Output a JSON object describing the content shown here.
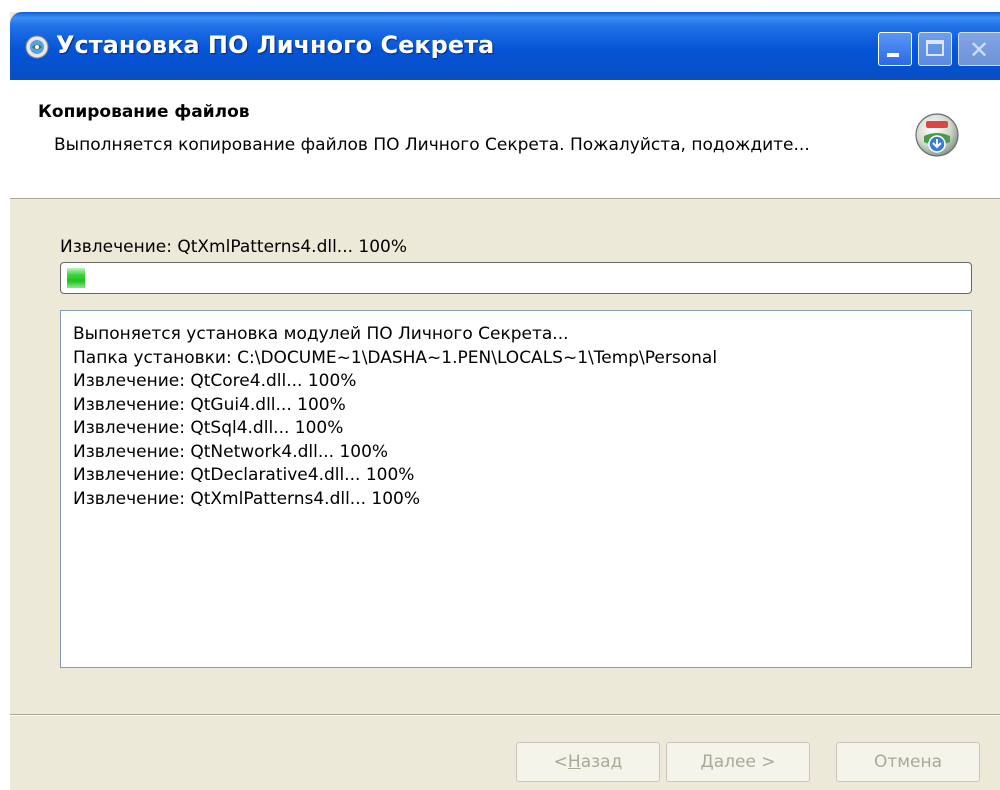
{
  "window": {
    "title": "Установка ПО Личного Секрета",
    "icon": "shield-globe-icon",
    "controls": [
      "minimize-icon",
      "maximize-icon",
      "close-icon"
    ]
  },
  "header": {
    "title": "Копирование файлов",
    "description": "Выполняется копирование файлов ПО Личного Секрета. Пожалуйста, подождите...",
    "icon": "installer-disc-icon"
  },
  "progress": {
    "status_text": "Извлечение: QtXmlPatterns4.dll... 100%",
    "fraction": 0.02,
    "color": "#20c020"
  },
  "log": {
    "lines": [
      "Выпоняется установка модулей ПО Личного Секрета...",
      "Папка установки: C:\\DOCUME~1\\DASHA~1.PEN\\LOCALS~1\\Temp\\Personal",
      "Извлечение: QtCore4.dll... 100%",
      "Извлечение: QtGui4.dll... 100%",
      "Извлечение: QtSql4.dll... 100%",
      "Извлечение: QtNetwork4.dll... 100%",
      "Извлечение: QtDeclarative4.dll... 100%",
      "Извлечение: QtXmlPatterns4.dll... 100%"
    ]
  },
  "buttons": {
    "back": {
      "prefix": "< ",
      "mnemonic": "Н",
      "rest": "азад",
      "enabled": false
    },
    "next": {
      "mnemonic": "Д",
      "rest": "алее >",
      "enabled": false
    },
    "cancel": {
      "label": "Отмена",
      "enabled": false
    }
  },
  "colors": {
    "titlebar": "#0555d6",
    "dialog_bg": "#ece9d8",
    "disabled_text": "#aca899"
  }
}
